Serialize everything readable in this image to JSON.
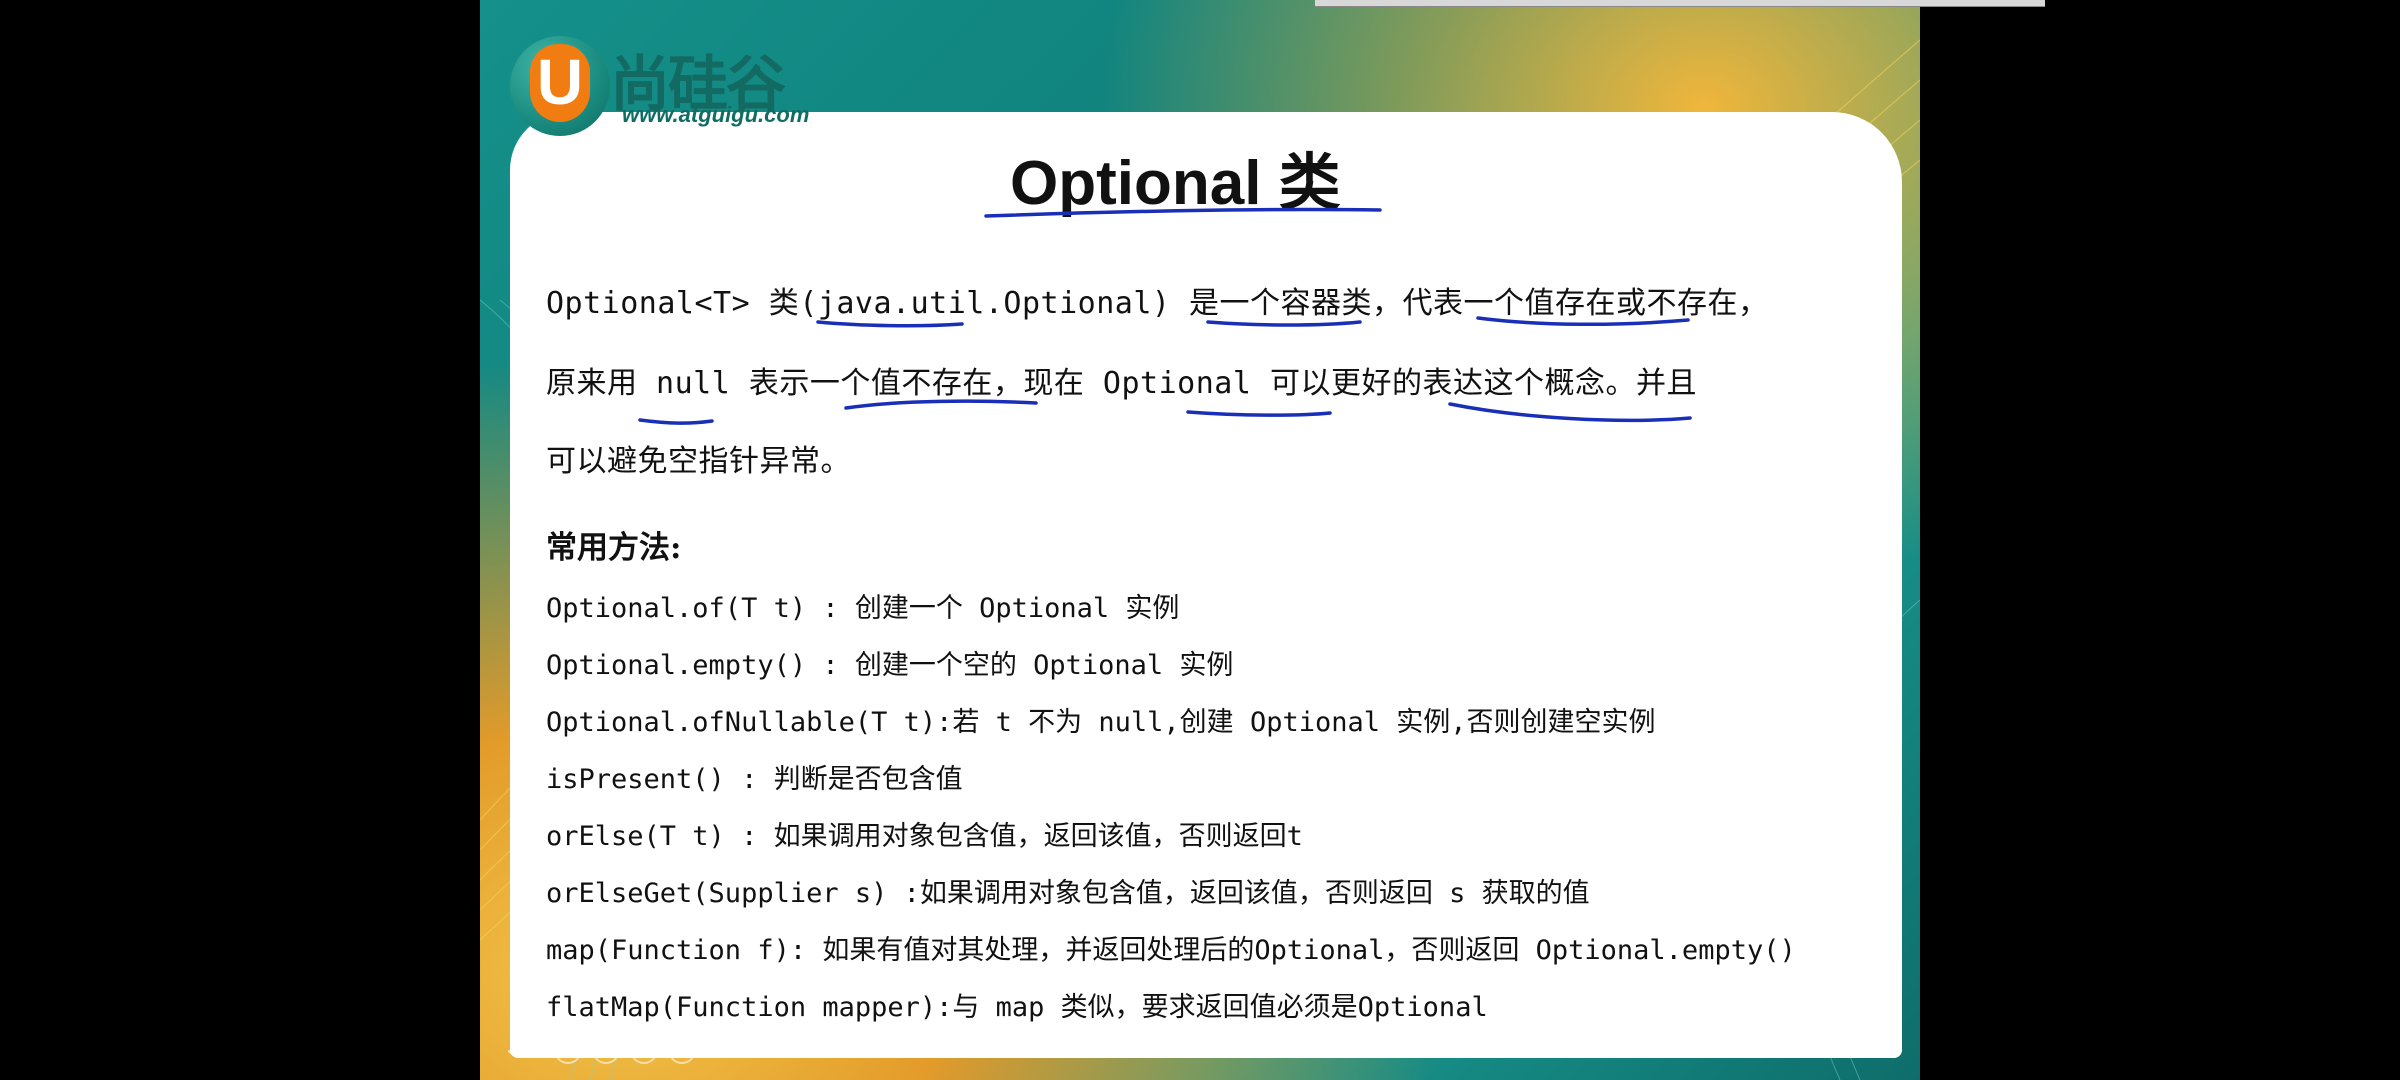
{
  "logo": {
    "letter": "U",
    "name_cn": "尚硅谷",
    "url": "www.atguigu.com"
  },
  "slide": {
    "title": "Optional 类",
    "paragraph_lines": [
      "Optional<T> 类(java.util.Optional) 是一个容器类，代表一个值存在或不存在，",
      "原来用 null 表示一个值不存在，现在 Optional 可以更好的表达这个概念。并且",
      "可以避免空指针异常。"
    ],
    "section_title": "常用方法:",
    "methods": [
      "Optional.of(T t) : 创建一个 Optional 实例",
      "Optional.empty() : 创建一个空的 Optional 实例",
      "Optional.ofNullable(T t):若 t 不为 null,创建 Optional 实例,否则创建空实例",
      "isPresent() : 判断是否包含值",
      "orElse(T t) :  如果调用对象包含值，返回该值，否则返回t",
      "orElseGet(Supplier s) :如果调用对象包含值，返回该值，否则返回 s 获取的值",
      "map(Function f): 如果有值对其处理，并返回处理后的Optional，否则返回 Optional.empty()",
      "flatMap(Function mapper):与 map 类似，要求返回值必须是Optional"
    ]
  },
  "player_controls": [
    {
      "name": "prev-slide-icon",
      "glyph": "‹"
    },
    {
      "name": "next-slide-icon",
      "glyph": "›"
    },
    {
      "name": "pen-icon",
      "glyph": "✎"
    },
    {
      "name": "grid-icon",
      "glyph": "▦"
    },
    {
      "name": "zoom-icon",
      "glyph": "⌕"
    },
    {
      "name": "more-icon",
      "glyph": "⋯"
    }
  ],
  "colors": {
    "teal": "#15908a",
    "orange": "#f07c12",
    "annotation_blue": "#1a2fb8"
  }
}
